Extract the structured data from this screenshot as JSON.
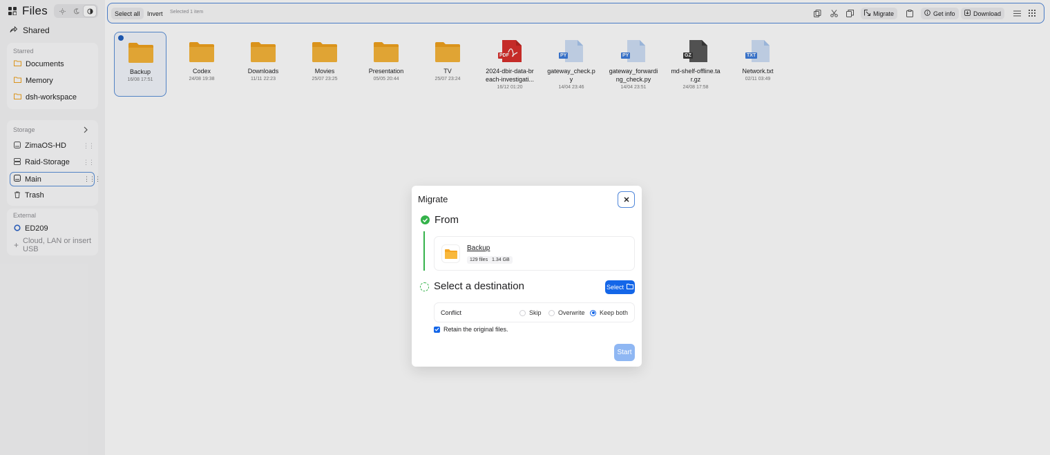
{
  "app": {
    "title": "Files",
    "theme_modes": [
      "light",
      "dark",
      "auto"
    ]
  },
  "sidebar": {
    "shared_label": "Shared",
    "starred_section": "Starred",
    "starred": [
      {
        "label": "Documents",
        "icon": "folder-icon"
      },
      {
        "label": "Memory",
        "icon": "folder-icon"
      },
      {
        "label": "dsh-workspace",
        "icon": "folder-icon"
      }
    ],
    "storage_section": "Storage",
    "storage": [
      {
        "label": "ZimaOS-HD",
        "icon": "disk-icon"
      },
      {
        "label": "Raid-Storage",
        "icon": "raid-icon"
      },
      {
        "label": "Main",
        "icon": "disk-icon",
        "active": true
      },
      {
        "label": "Trash",
        "icon": "trash-icon"
      }
    ],
    "external_section": "External",
    "external": [
      {
        "label": "ED209",
        "icon": "network-icon"
      }
    ],
    "add_label": "Cloud, LAN or insert USB"
  },
  "toolbar": {
    "select_all": "Select all",
    "invert": "Invert",
    "selected_info": "Selected 1 item",
    "migrate": "Migrate",
    "get_info": "Get info",
    "download": "Download"
  },
  "files": [
    {
      "name": "Backup",
      "date": "16/08 17:51",
      "type": "folder",
      "selected": true
    },
    {
      "name": "Codex",
      "date": "24/08 19:38",
      "type": "folder"
    },
    {
      "name": "Downloads",
      "date": "11/11 22:23",
      "type": "folder"
    },
    {
      "name": "Movies",
      "date": "25/07 23:25",
      "type": "folder"
    },
    {
      "name": "Presentation",
      "date": "05/05 20:44",
      "type": "folder"
    },
    {
      "name": "TV",
      "date": "25/07 23:24",
      "type": "folder"
    },
    {
      "name": "2024-dbir-data-breach-investigati...",
      "date": "16/12 01:20",
      "type": "pdf",
      "badge": "PDF"
    },
    {
      "name": "gateway_check.py",
      "date": "14/04 23:46",
      "type": "py",
      "badge": "PY"
    },
    {
      "name": "gateway_forwarding_check.py",
      "date": "14/04 23:51",
      "type": "py",
      "badge": "PY"
    },
    {
      "name": "md-shelf-offline.tar.gz",
      "date": "24/08 17:58",
      "type": "gz",
      "badge": "GZ"
    },
    {
      "name": "Network.txt",
      "date": "02/11 03:49",
      "type": "txt",
      "badge": "TXT"
    }
  ],
  "modal": {
    "title": "Migrate",
    "from_label": "From",
    "source_name": "Backup",
    "source_files": "129 files",
    "source_size": "1.34 GB",
    "dest_label": "Select a destination",
    "select_label": "Select",
    "conflict_label": "Conflict",
    "options": [
      "Skip",
      "Overwrite",
      "Keep both"
    ],
    "selected_option": "Keep both",
    "retain_label": "Retain the original files.",
    "retain_checked": true,
    "start_label": "Start"
  },
  "colors": {
    "accent": "#1466e8",
    "folder": "#f5a623",
    "success": "#34b24a",
    "pdf": "#d9302c"
  }
}
